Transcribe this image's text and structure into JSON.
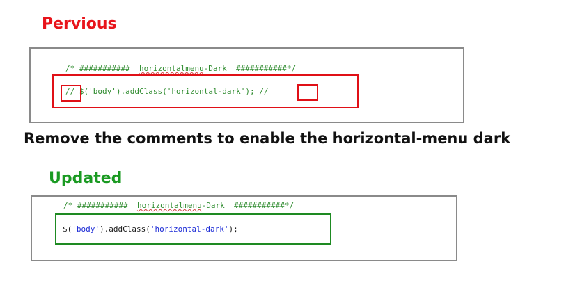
{
  "headings": {
    "previous": "Pervious",
    "updated": "Updated"
  },
  "instruction": "Remove the comments to enable the horizontal-menu dark",
  "previous_code": {
    "comment_prefix": "/* ###########  ",
    "comment_word": "horizontalmenu",
    "comment_suffix": "-Dark  ###########*/",
    "line_prefix": "// ",
    "line_dollar": "$(",
    "line_arg1": "'body'",
    "line_mid": ").addClass(",
    "line_arg2": "'horizontal-dark'",
    "line_end": "); ",
    "line_suffix": "//"
  },
  "updated_code": {
    "comment_prefix": "/* ###########  ",
    "comment_word": "horizontalmenu",
    "comment_suffix": "-Dark  ###########*/",
    "line_dollar": "$(",
    "line_arg1": "'body'",
    "line_mid": ").addClass(",
    "line_arg2": "'horizontal-dark'",
    "line_end": ");"
  },
  "colors": {
    "previous_accent": "#e01017",
    "updated_accent": "#1e8a22",
    "comment": "#2e8b2e",
    "string": "#1c2bd6"
  }
}
